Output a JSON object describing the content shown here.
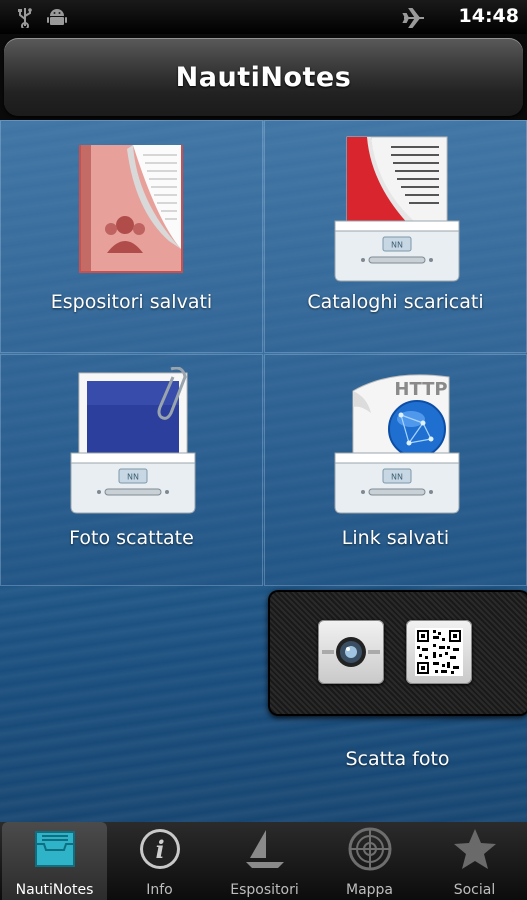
{
  "status_bar": {
    "time": "14:48",
    "icons": [
      "usb-icon",
      "android-icon",
      "airplane-icon"
    ]
  },
  "app": {
    "title": "NautiNotes"
  },
  "tiles": [
    {
      "label": "Espositori salvati",
      "icon": "saved-exhibitors-book-icon"
    },
    {
      "label": "Cataloghi scaricati",
      "icon": "downloaded-catalogs-box-icon"
    },
    {
      "label": "Foto scattate",
      "icon": "photos-box-icon"
    },
    {
      "label": "Link salvati",
      "icon": "saved-links-http-globe-icon"
    }
  ],
  "camera_panel": {
    "label": "Scatta foto",
    "buttons": [
      "camera-icon",
      "qr-code-icon"
    ]
  },
  "box_badge": "NN",
  "http_text": "HTTP",
  "tabs": [
    {
      "label": "NautiNotes",
      "icon": "inbox-tray-icon",
      "active": true
    },
    {
      "label": "Info",
      "icon": "info-icon",
      "active": false
    },
    {
      "label": "Espositori",
      "icon": "sailboat-icon",
      "active": false
    },
    {
      "label": "Mappa",
      "icon": "radar-map-icon",
      "active": false
    },
    {
      "label": "Social",
      "icon": "star-icon",
      "active": false
    }
  ],
  "colors": {
    "accent": "#2fb3c8",
    "sea": "#2d6597"
  }
}
